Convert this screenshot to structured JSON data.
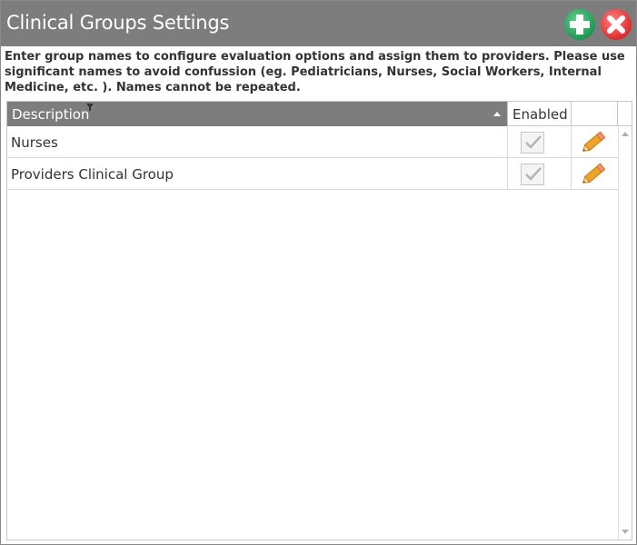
{
  "window": {
    "title": "Clinical Groups Settings",
    "instructions": "Enter group names to configure evaluation options and assign them to providers. Please use significant names to avoid confussion (eg. Pediatricians, Nurses, Social Workers, Internal Medicine, etc. ). Names cannot be repeated.",
    "add_icon": "plus-circle-icon",
    "close_icon": "x-circle-icon",
    "colors": {
      "titlebar": "#7d7d7d",
      "add": "#1e9a55",
      "close": "#e02d2d",
      "pencil": "#f0a32a"
    }
  },
  "grid": {
    "columns": {
      "description": "Description",
      "enabled": "Enabled"
    },
    "rows": [
      {
        "description": "Nurses",
        "enabled": true
      },
      {
        "description": "Providers Clinical Group",
        "enabled": true
      }
    ]
  }
}
